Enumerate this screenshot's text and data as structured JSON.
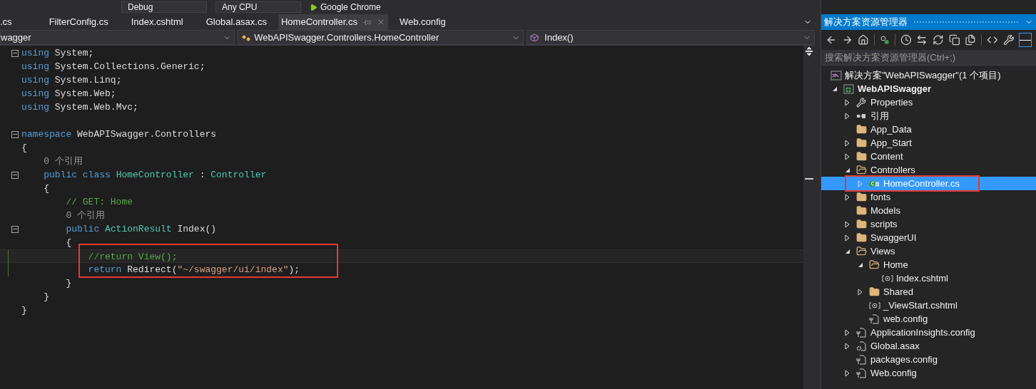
{
  "toolbar": {
    "configuration": "Debug",
    "platform": "Any CPU",
    "run_target": "Google Chrome"
  },
  "tabs": [
    {
      "label": ".cs",
      "selected": false
    },
    {
      "label": "FilterConfig.cs",
      "selected": false
    },
    {
      "label": "Index.cshtml",
      "selected": false
    },
    {
      "label": "Global.asax.cs",
      "selected": false
    },
    {
      "label": "HomeController.cs",
      "selected": true
    },
    {
      "label": "Web.config",
      "selected": false
    }
  ],
  "navigation_bar": {
    "project": "wagger",
    "type": "WebAPISwagger.Controllers.HomeController",
    "member": "Index()"
  },
  "code": {
    "lines": [
      {
        "kind": "code",
        "foldable": true,
        "tokens": [
          {
            "kind": "keyword",
            "text": "using"
          },
          {
            "kind": "plain",
            "text": " System;"
          }
        ]
      },
      {
        "kind": "code",
        "tokens": [
          {
            "kind": "keyword",
            "text": "using"
          },
          {
            "kind": "plain",
            "text": " System.Collections.Generic;"
          }
        ]
      },
      {
        "kind": "code",
        "tokens": [
          {
            "kind": "keyword",
            "text": "using"
          },
          {
            "kind": "plain",
            "text": " System.Linq;"
          }
        ]
      },
      {
        "kind": "code",
        "tokens": [
          {
            "kind": "keyword",
            "text": "using"
          },
          {
            "kind": "plain",
            "text": " System.Web;"
          }
        ]
      },
      {
        "kind": "code",
        "tokens": [
          {
            "kind": "keyword",
            "text": "using"
          },
          {
            "kind": "plain",
            "text": " System.Web.Mvc;"
          }
        ]
      },
      {
        "kind": "blank"
      },
      {
        "kind": "code",
        "foldable": true,
        "tokens": [
          {
            "kind": "keyword",
            "text": "namespace"
          },
          {
            "kind": "plain",
            "text": " WebAPISwagger.Controllers"
          }
        ]
      },
      {
        "kind": "code",
        "tokens": [
          {
            "kind": "plain",
            "text": "{"
          }
        ]
      },
      {
        "kind": "code",
        "tokens": [
          {
            "kind": "codelens",
            "text": "    0 个引用"
          }
        ]
      },
      {
        "kind": "code",
        "foldable": true,
        "tokens": [
          {
            "kind": "keyword",
            "text": "    public class"
          },
          {
            "kind": "type",
            "text": " HomeController"
          },
          {
            "kind": "plain",
            "text": " : "
          },
          {
            "kind": "type",
            "text": "Controller"
          }
        ]
      },
      {
        "kind": "code",
        "tokens": [
          {
            "kind": "plain",
            "text": "    {"
          }
        ]
      },
      {
        "kind": "code",
        "tokens": [
          {
            "kind": "comment",
            "text": "        // GET: Home"
          }
        ]
      },
      {
        "kind": "code",
        "tokens": [
          {
            "kind": "codelens",
            "text": "        0 个引用"
          }
        ]
      },
      {
        "kind": "code",
        "foldable": true,
        "tokens": [
          {
            "kind": "keyword",
            "text": "        public"
          },
          {
            "kind": "type",
            "text": " ActionResult"
          },
          {
            "kind": "plain",
            "text": " Index()"
          }
        ]
      },
      {
        "kind": "code",
        "tokens": [
          {
            "kind": "plain",
            "text": "        {"
          }
        ]
      },
      {
        "kind": "code",
        "modified": true,
        "current": true,
        "boxed": true,
        "tokens": [
          {
            "kind": "comment",
            "text": "            //return View();"
          }
        ]
      },
      {
        "kind": "code",
        "modified": true,
        "boxed": true,
        "tokens": [
          {
            "kind": "keyword",
            "text": "            return"
          },
          {
            "kind": "plain",
            "text": " Redirect("
          },
          {
            "kind": "string",
            "text": "\"~/swagger/ui/index\""
          },
          {
            "kind": "plain",
            "text": ");"
          }
        ]
      },
      {
        "kind": "code",
        "tokens": [
          {
            "kind": "plain",
            "text": "        }"
          }
        ]
      },
      {
        "kind": "code",
        "tokens": [
          {
            "kind": "plain",
            "text": "    }"
          }
        ]
      },
      {
        "kind": "code",
        "tokens": [
          {
            "kind": "plain",
            "text": "}"
          }
        ]
      }
    ]
  },
  "solution_explorer": {
    "title": "解决方案资源管理器",
    "search": {
      "placeholder": "搜索解决方案资源管理器(Ctrl+;)"
    },
    "tree": [
      {
        "label": "解决方案\"WebAPISwagger\"(1 个项目)",
        "kind": "solution",
        "selected": false,
        "children": [
          {
            "label": "WebAPISwagger",
            "kind": "project",
            "expanded": true,
            "selected": false,
            "children": [
              {
                "label": "Properties",
                "kind": "wrench",
                "expanded": false,
                "selected": false
              },
              {
                "label": "引用",
                "kind": "references",
                "expanded": false,
                "selected": false
              },
              {
                "label": "App_Data",
                "kind": "folder",
                "selected": false
              },
              {
                "label": "App_Start",
                "kind": "folder",
                "expanded": false,
                "selected": false
              },
              {
                "label": "Content",
                "kind": "folder",
                "expanded": false,
                "selected": false
              },
              {
                "label": "Controllers",
                "kind": "folder",
                "expanded": true,
                "selected": false,
                "children": [
                  {
                    "label": "HomeController.cs",
                    "kind": "csharp",
                    "expanded": false,
                    "selected": true,
                    "boxed": true
                  }
                ]
              },
              {
                "label": "fonts",
                "kind": "folder",
                "expanded": false,
                "selected": false
              },
              {
                "label": "Models",
                "kind": "folder",
                "selected": false
              },
              {
                "label": "scripts",
                "kind": "folder",
                "expanded": false,
                "selected": false
              },
              {
                "label": "SwaggerUI",
                "kind": "folder",
                "expanded": false,
                "selected": false
              },
              {
                "label": "Views",
                "kind": "folder",
                "expanded": true,
                "selected": false,
                "children": [
                  {
                    "label": "Home",
                    "kind": "folder",
                    "expanded": true,
                    "selected": false,
                    "children": [
                      {
                        "label": "Index.cshtml",
                        "kind": "razor",
                        "selected": false
                      }
                    ]
                  },
                  {
                    "label": "Shared",
                    "kind": "folder",
                    "expanded": false,
                    "selected": false
                  },
                  {
                    "label": "_ViewStart.cshtml",
                    "kind": "razor",
                    "selected": false
                  },
                  {
                    "label": "web.config",
                    "kind": "config",
                    "selected": false
                  }
                ]
              },
              {
                "label": "ApplicationInsights.config",
                "kind": "config",
                "expanded": false,
                "selected": false
              },
              {
                "label": "Global.asax",
                "kind": "asax",
                "expanded": false,
                "selected": false
              },
              {
                "label": "packages.config",
                "kind": "config",
                "selected": false
              },
              {
                "label": "Web.config",
                "kind": "config",
                "expanded": false,
                "selected": false
              }
            ]
          }
        ]
      }
    ]
  }
}
